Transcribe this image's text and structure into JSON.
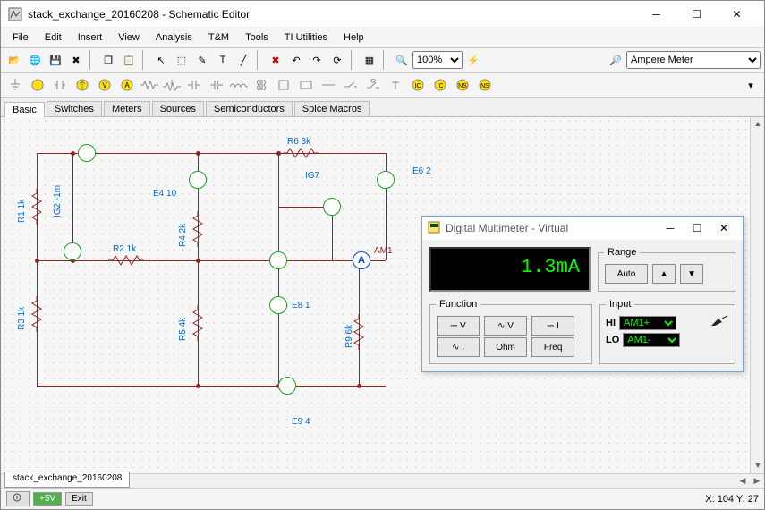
{
  "window": {
    "title": "stack_exchange_20160208 - Schematic Editor"
  },
  "menu": [
    "File",
    "Edit",
    "Insert",
    "View",
    "Analysis",
    "T&M",
    "Tools",
    "TI Utilities",
    "Help"
  ],
  "toolbar": {
    "zoom": "100%",
    "instrument_picker": "Ampere Meter"
  },
  "component_tabs": [
    "Basic",
    "Switches",
    "Meters",
    "Sources",
    "Semiconductors",
    "Spice Macros"
  ],
  "active_component_tab": "Basic",
  "doc_tab": "stack_exchange_20160208",
  "status": {
    "v_btn": "+5V",
    "exit_btn": "Exit",
    "coords": "X: 104 Y: 27"
  },
  "circuit_labels": {
    "R1": "R1 1k",
    "R2": "R2 1k",
    "R3": "R3 1k",
    "R4": "R4 2k",
    "R5": "R5 4k",
    "R6": "R6 3k",
    "R9": "R9 6k",
    "IG2": "IG2 -1m",
    "IG7": "IG7",
    "E4": "E4 10",
    "E6": "E6 2",
    "E8": "E8 1",
    "E9": "E9 4",
    "AM1": "AM1"
  },
  "dmm": {
    "title": "Digital Multimeter - Virtual",
    "display": "1.3mA",
    "range_label": "Range",
    "range_auto": "Auto",
    "function_label": "Function",
    "input_label": "Input",
    "hi_label": "HI",
    "lo_label": "LO",
    "hi_val": "AM1+",
    "lo_val": "AM1-",
    "fn_dcv": "⎓ V",
    "fn_acv": "∿ V",
    "fn_dci": "⎓ I",
    "fn_aci": "∿ I",
    "fn_ohm": "Ohm",
    "fn_freq": "Freq"
  }
}
